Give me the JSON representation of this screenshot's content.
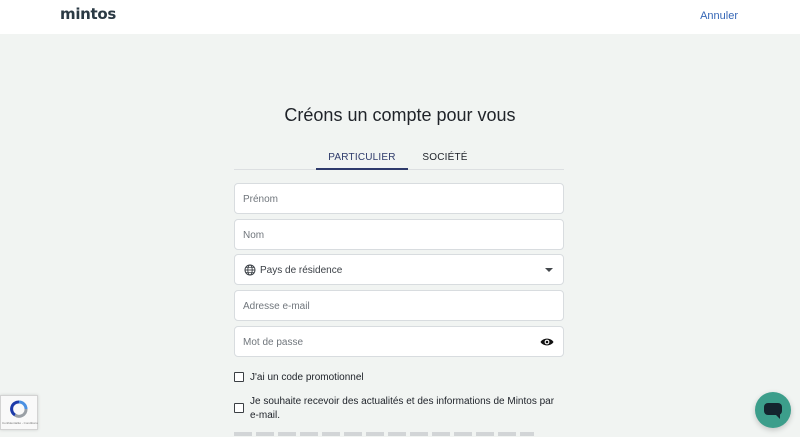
{
  "header": {
    "logo": "mintos",
    "cancel_label": "Annuler"
  },
  "page_title": "Créons un compte pour vous",
  "tabs": [
    {
      "label": "PARTICULIER",
      "active": true
    },
    {
      "label": "SOCIÉTÉ",
      "active": false
    }
  ],
  "form": {
    "first_name_placeholder": "Prénom",
    "last_name_placeholder": "Nom",
    "country_placeholder": "Pays de résidence",
    "country_icon": "globe-icon",
    "email_placeholder": "Adresse e-mail",
    "password_placeholder": "Mot de passe",
    "password_icon": "eye-icon"
  },
  "checkboxes": {
    "promo_label": "J'ai un code promotionnel",
    "promo_checked": false,
    "newsletter_label": "Je souhaite recevoir des actualités et des informations de Mintos par e-mail.",
    "newsletter_checked": false
  },
  "widgets": {
    "recaptcha_text": "Confidentialité - Conditions",
    "chat_icon": "chat-bubble-icon"
  },
  "colors": {
    "accent": "#2e3a6b",
    "link": "#3566b6",
    "chat": "#3c9e8b",
    "background": "#f1f4f2"
  }
}
